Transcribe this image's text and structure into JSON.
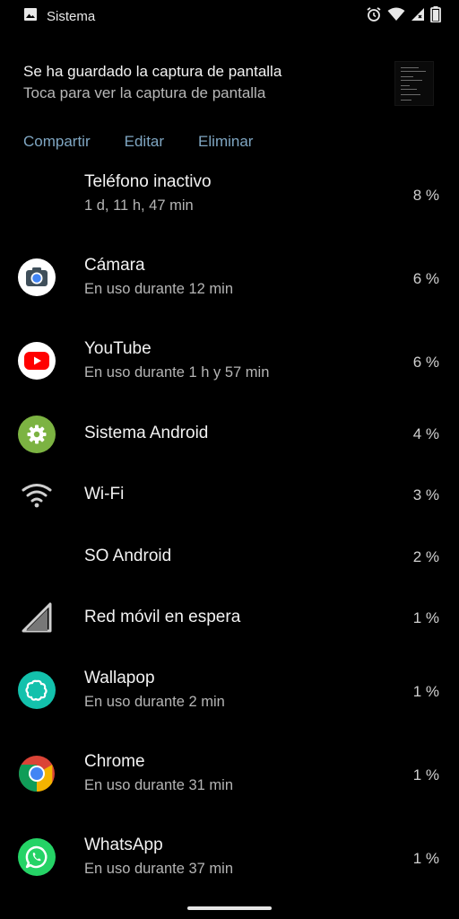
{
  "status_bar": {
    "title": "Sistema"
  },
  "notification": {
    "title": "Se ha guardado la captura de pantalla",
    "subtitle": "Toca para ver la captura de pantalla",
    "actions": [
      "Compartir",
      "Editar",
      "Eliminar"
    ]
  },
  "apps": [
    {
      "label": "Teléfono inactivo",
      "sub": "1 d, 11 h, 47 min",
      "pct": "8 %",
      "icon": "none"
    },
    {
      "label": "Cámara",
      "sub": "En uso durante 12 min",
      "pct": "6 %",
      "icon": "camera-icon"
    },
    {
      "label": "YouTube",
      "sub": "En uso durante 1 h y 57 min",
      "pct": "6 %",
      "icon": "youtube-icon"
    },
    {
      "label": "Sistema Android",
      "sub": "",
      "pct": "4 %",
      "icon": "android-settings-icon"
    },
    {
      "label": "Wi-Fi",
      "sub": "",
      "pct": "3 %",
      "icon": "wifi-icon"
    },
    {
      "label": "SO Android",
      "sub": "",
      "pct": "2 %",
      "icon": "none"
    },
    {
      "label": "Red móvil en espera",
      "sub": "",
      "pct": "1 %",
      "icon": "cell-signal-icon"
    },
    {
      "label": "Wallapop",
      "sub": "En uso durante 2 min",
      "pct": "1 %",
      "icon": "wallapop-icon"
    },
    {
      "label": "Chrome",
      "sub": "En uso durante 31 min",
      "pct": "1 %",
      "icon": "chrome-icon"
    },
    {
      "label": "WhatsApp",
      "sub": "En uso durante 37 min",
      "pct": "1 %",
      "icon": "whatsapp-icon"
    }
  ]
}
